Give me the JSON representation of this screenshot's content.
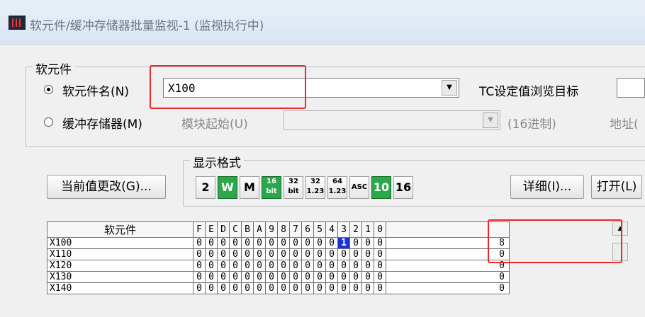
{
  "window": {
    "title": "软元件/缓冲存储器批量监视-1 (监视执行中)"
  },
  "device_group": {
    "label": "软元件",
    "device_radio_label": "软元件名(N)",
    "device_value": "X100",
    "tc_label": "TC设定值浏览目标",
    "buffer_radio_label": "缓冲存储器(M)",
    "module_start_label": "模块起始(U)",
    "hex_label": "(16进制)",
    "address_label": "地址("
  },
  "display_format": {
    "label": "显示格式",
    "buttons": [
      {
        "text": "2",
        "active": false
      },
      {
        "text": "W",
        "active": true
      },
      {
        "text": "M",
        "active": false
      },
      {
        "text": "16 bit",
        "active": true
      },
      {
        "text": "32 bit",
        "active": false
      },
      {
        "text": "32 1.23",
        "active": false
      },
      {
        "text": "64 1.23",
        "active": false
      },
      {
        "text": "ASC",
        "active": false
      },
      {
        "text": "10",
        "active": true
      },
      {
        "text": "16",
        "active": false
      }
    ]
  },
  "buttons": {
    "change_value": "当前值更改(G)...",
    "detail": "详细(I)...",
    "open": "打开(L)"
  },
  "table": {
    "device_header": "软元件",
    "bit_headers": [
      "F",
      "E",
      "D",
      "C",
      "B",
      "A",
      "9",
      "8",
      "7",
      "6",
      "5",
      "4",
      "3",
      "2",
      "1",
      "0"
    ],
    "rows": [
      {
        "name": "X100",
        "bits": [
          "0",
          "0",
          "0",
          "0",
          "0",
          "0",
          "0",
          "0",
          "0",
          "0",
          "0",
          "0",
          "1",
          "0",
          "0",
          "0"
        ],
        "value": "8"
      },
      {
        "name": "X110",
        "bits": [
          "0",
          "0",
          "0",
          "0",
          "0",
          "0",
          "0",
          "0",
          "0",
          "0",
          "0",
          "0",
          "0",
          "0",
          "0",
          "0"
        ],
        "value": "0"
      },
      {
        "name": "X120",
        "bits": [
          "0",
          "0",
          "0",
          "0",
          "0",
          "0",
          "0",
          "0",
          "0",
          "0",
          "0",
          "0",
          "0",
          "0",
          "0",
          "0"
        ],
        "value": "0"
      },
      {
        "name": "X130",
        "bits": [
          "0",
          "0",
          "0",
          "0",
          "0",
          "0",
          "0",
          "0",
          "0",
          "0",
          "0",
          "0",
          "0",
          "0",
          "0",
          "0"
        ],
        "value": "0"
      },
      {
        "name": "X140",
        "bits": [
          "0",
          "0",
          "0",
          "0",
          "0",
          "0",
          "0",
          "0",
          "0",
          "0",
          "0",
          "0",
          "0",
          "0",
          "0",
          "0"
        ],
        "value": "0"
      }
    ]
  },
  "colors": {
    "highlight": "#e8282a",
    "active_format": "#2aa84a",
    "selected_bit": "#1a2fe0"
  }
}
